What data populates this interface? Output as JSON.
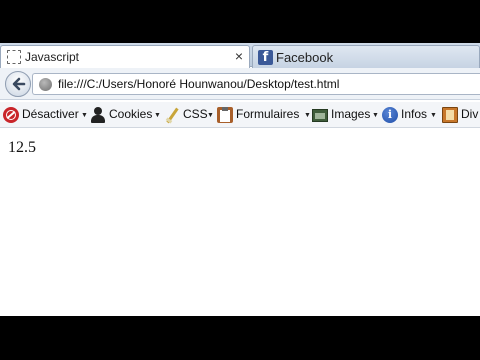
{
  "tabs": [
    {
      "title": "Javascript",
      "icon": "blank-page-icon",
      "close": "×"
    },
    {
      "title": "Facebook",
      "icon": "facebook-icon",
      "icon_glyph": "f"
    }
  ],
  "navbar": {
    "url": "file:///C:/Users/Honoré Hounwanou/Desktop/test.html"
  },
  "devbar": {
    "items": [
      {
        "label": "Désactiver",
        "icon": "disable-icon"
      },
      {
        "label": "Cookies",
        "icon": "user-icon"
      },
      {
        "label": "CSS",
        "icon": "pencil-icon"
      },
      {
        "label": "Formulaires",
        "icon": "clipboard-icon"
      },
      {
        "label": "Images",
        "icon": "image-icon"
      },
      {
        "label": "Infos",
        "icon": "info-icon",
        "icon_glyph": "i"
      },
      {
        "label": "Div",
        "icon": "book-icon"
      }
    ],
    "dropdown_glyph": "▼"
  },
  "page": {
    "text": "12.5"
  },
  "colors": {
    "facebook": "#3b5998",
    "toolbar": "#f3f5f8",
    "tabstrip": "#c6d3e3"
  }
}
